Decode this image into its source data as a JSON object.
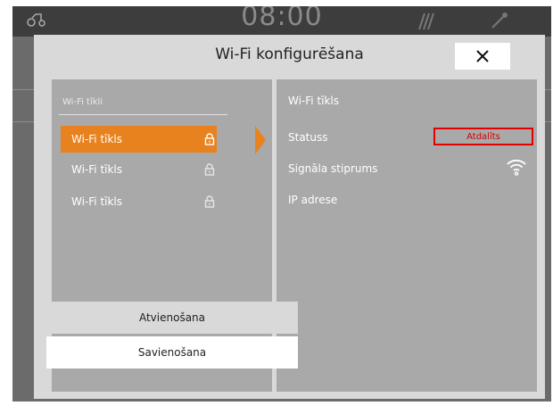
{
  "statusbar": {
    "clock": "08:00"
  },
  "dialog": {
    "title": "Wi-Fi konfigurēšana",
    "close_icon": "close-icon"
  },
  "networks": {
    "header": "Wi-Fi tīkli",
    "items": [
      {
        "label": "Wi-Fi tīkls",
        "selected": true,
        "icon": "lock-icon"
      },
      {
        "label": "Wi-Fi tīkls",
        "selected": false,
        "icon": "lock-icon"
      },
      {
        "label": "Wi-Fi tīkls",
        "selected": false,
        "icon": "lock-icon"
      }
    ]
  },
  "details": {
    "network_name": "Wi-Fi tīkls",
    "status_label": "Statuss",
    "status_value": "Atdalīts",
    "signal_label": "Signāla stiprums",
    "signal_icon": "wifi-signal-icon",
    "ip_label": "IP adrese",
    "disconnect_label": "Atvienošana",
    "connect_label": "Savienošana"
  },
  "colors": {
    "accent": "#e8821e",
    "status_red": "#d40000",
    "panel": "#a9a9a9",
    "dialog": "#d9d9d9"
  }
}
